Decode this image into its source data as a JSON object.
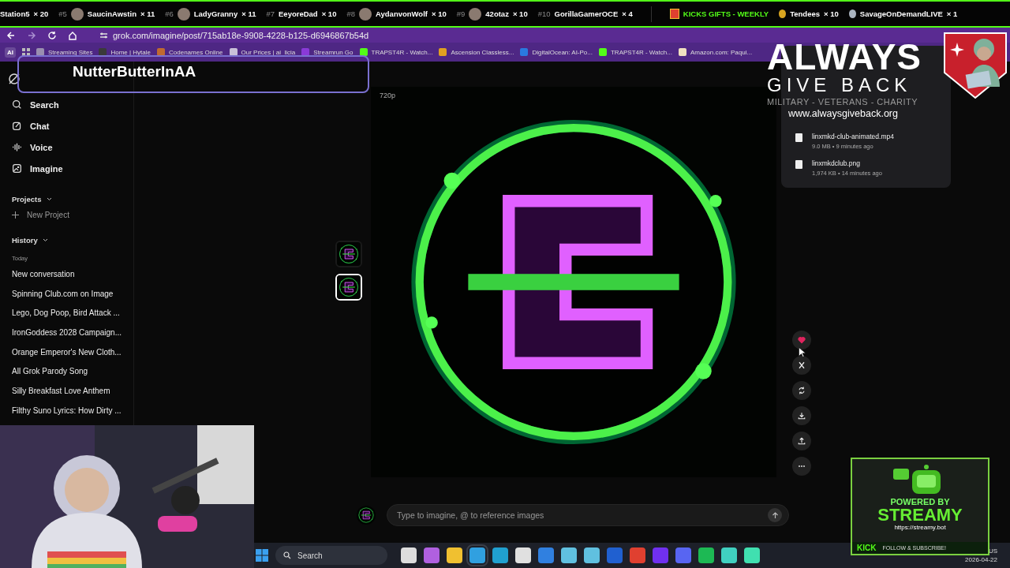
{
  "ticker": {
    "entries": [
      {
        "name": "Station5",
        "count": "× 20",
        "avatar": false
      },
      {
        "rank": "#5",
        "name": "SaucinAwstin",
        "count": "× 11",
        "avatar": true
      },
      {
        "rank": "#6",
        "name": "LadyGranny",
        "count": "× 11",
        "avatar": true
      },
      {
        "rank": "#7",
        "name": "EeyoreDad",
        "count": "× 10",
        "avatar": false
      },
      {
        "rank": "#8",
        "name": "AydanvonWolf",
        "count": "× 10",
        "avatar": true
      },
      {
        "rank": "#9",
        "name": "42otaz",
        "count": "× 10",
        "avatar": true
      },
      {
        "rank": "#10",
        "name": "GorillaGamerOCE",
        "count": "× 4",
        "avatar": false
      }
    ],
    "gifts_title": "KICKS GIFTS - WEEKLY",
    "gifts": [
      {
        "name": "Tendees",
        "count": "× 10",
        "color": "#d9a520"
      },
      {
        "name": "SavageOnDemandLIVE",
        "count": "× 1",
        "color": "#aab4c0"
      }
    ]
  },
  "browser": {
    "url": "grok.com/imagine/post/715ab18e-9908-4228-b125-d6946867b54d",
    "ai_button": "AI",
    "bookmarks": [
      {
        "label": "Streaming Sites",
        "color": "#9a8fb0"
      },
      {
        "label": "Home | Hytale",
        "color": "#3a3a3a"
      },
      {
        "label": "Codenames Online",
        "color": "#c06a30"
      },
      {
        "label": "Our Prices | ai_licia",
        "color": "#c8c0d8"
      },
      {
        "label": "Streamrun Go",
        "color": "#8a3ad8"
      },
      {
        "label": "TRAPST4R - Watch...",
        "color": "#53fc18"
      },
      {
        "label": "Ascension Classless...",
        "color": "#e0a020"
      },
      {
        "label": "DigitalOcean: AI-Po...",
        "color": "#2a7ae0"
      },
      {
        "label": "TRAPST4R - Watch...",
        "color": "#53fc18"
      },
      {
        "label": "Amazon.com: Paqui...",
        "color": "#f0e0c0"
      }
    ]
  },
  "name_tag": "NutterButterInAA",
  "sidebar": {
    "nav": [
      {
        "kind": "search",
        "label": "Search"
      },
      {
        "kind": "chat",
        "label": "Chat"
      },
      {
        "kind": "voice",
        "label": "Voice"
      },
      {
        "kind": "imagine",
        "label": "Imagine"
      }
    ],
    "projects_title": "Projects",
    "new_project": "New Project",
    "history_title": "History",
    "today": "Today",
    "history": [
      "New conversation",
      "Spinning Club.com on Image",
      "Lego, Dog Poop, Bird Attack ...",
      "IronGoddess 2028 Campaign...",
      "Orange Emperor's New Cloth...",
      "All Grok Parody Song",
      "Silly Breakfast Love Anthem",
      "Filthy Suno Lyrics: How Dirty ..."
    ]
  },
  "viewer": {
    "quality": "720p",
    "thumbnails": [
      {
        "selected": false
      },
      {
        "selected": true
      }
    ],
    "actions": [
      {
        "kind": "heart",
        "on": true
      },
      {
        "kind": "x"
      },
      {
        "kind": "regenerate"
      },
      {
        "kind": "download"
      },
      {
        "kind": "share"
      },
      {
        "kind": "more"
      }
    ],
    "prompt": {
      "placeholder": "Type to imagine, @ to reference images"
    }
  },
  "downloads": [
    {
      "name": "linxmkd-club-animated.mp4",
      "meta": "9.0 MB • 9 minutes ago"
    },
    {
      "name": "linxmkdclub.png",
      "meta": "1,974 KB • 14 minutes ago"
    }
  ],
  "charity_overlay": {
    "line_1": "ALWAYS",
    "line_2": "GIVE BACK",
    "tagline": "MILITARY - VETERANS - CHARITY",
    "url": "www.alwaysgiveback.org"
  },
  "streamy_overlay": {
    "powered": "POWERED BY",
    "brand": "STREAMY",
    "url": "https://streamy.bot",
    "platform": "KICK",
    "cta": "FOLLOW & SUBSCRIBE!"
  },
  "taskbar": {
    "search": "Search",
    "apps": [
      {
        "color": "#dddddd"
      },
      {
        "color": "#b060e0"
      },
      {
        "color": "#f0c030"
      },
      {
        "color": "#30a0e0",
        "selected": true
      },
      {
        "color": "#20a0d0"
      },
      {
        "color": "#e0e0e0"
      },
      {
        "color": "#3080e0"
      },
      {
        "color": "#60c0e0"
      },
      {
        "color": "#60c0e0"
      },
      {
        "color": "#2060d0"
      },
      {
        "color": "#e04030"
      },
      {
        "color": "#7030f0"
      },
      {
        "color": "#5865f2"
      },
      {
        "color": "#1db954"
      },
      {
        "color": "#40d0c0"
      },
      {
        "color": "#40e0b0"
      }
    ],
    "language": "US",
    "date": "2026-04-22"
  }
}
